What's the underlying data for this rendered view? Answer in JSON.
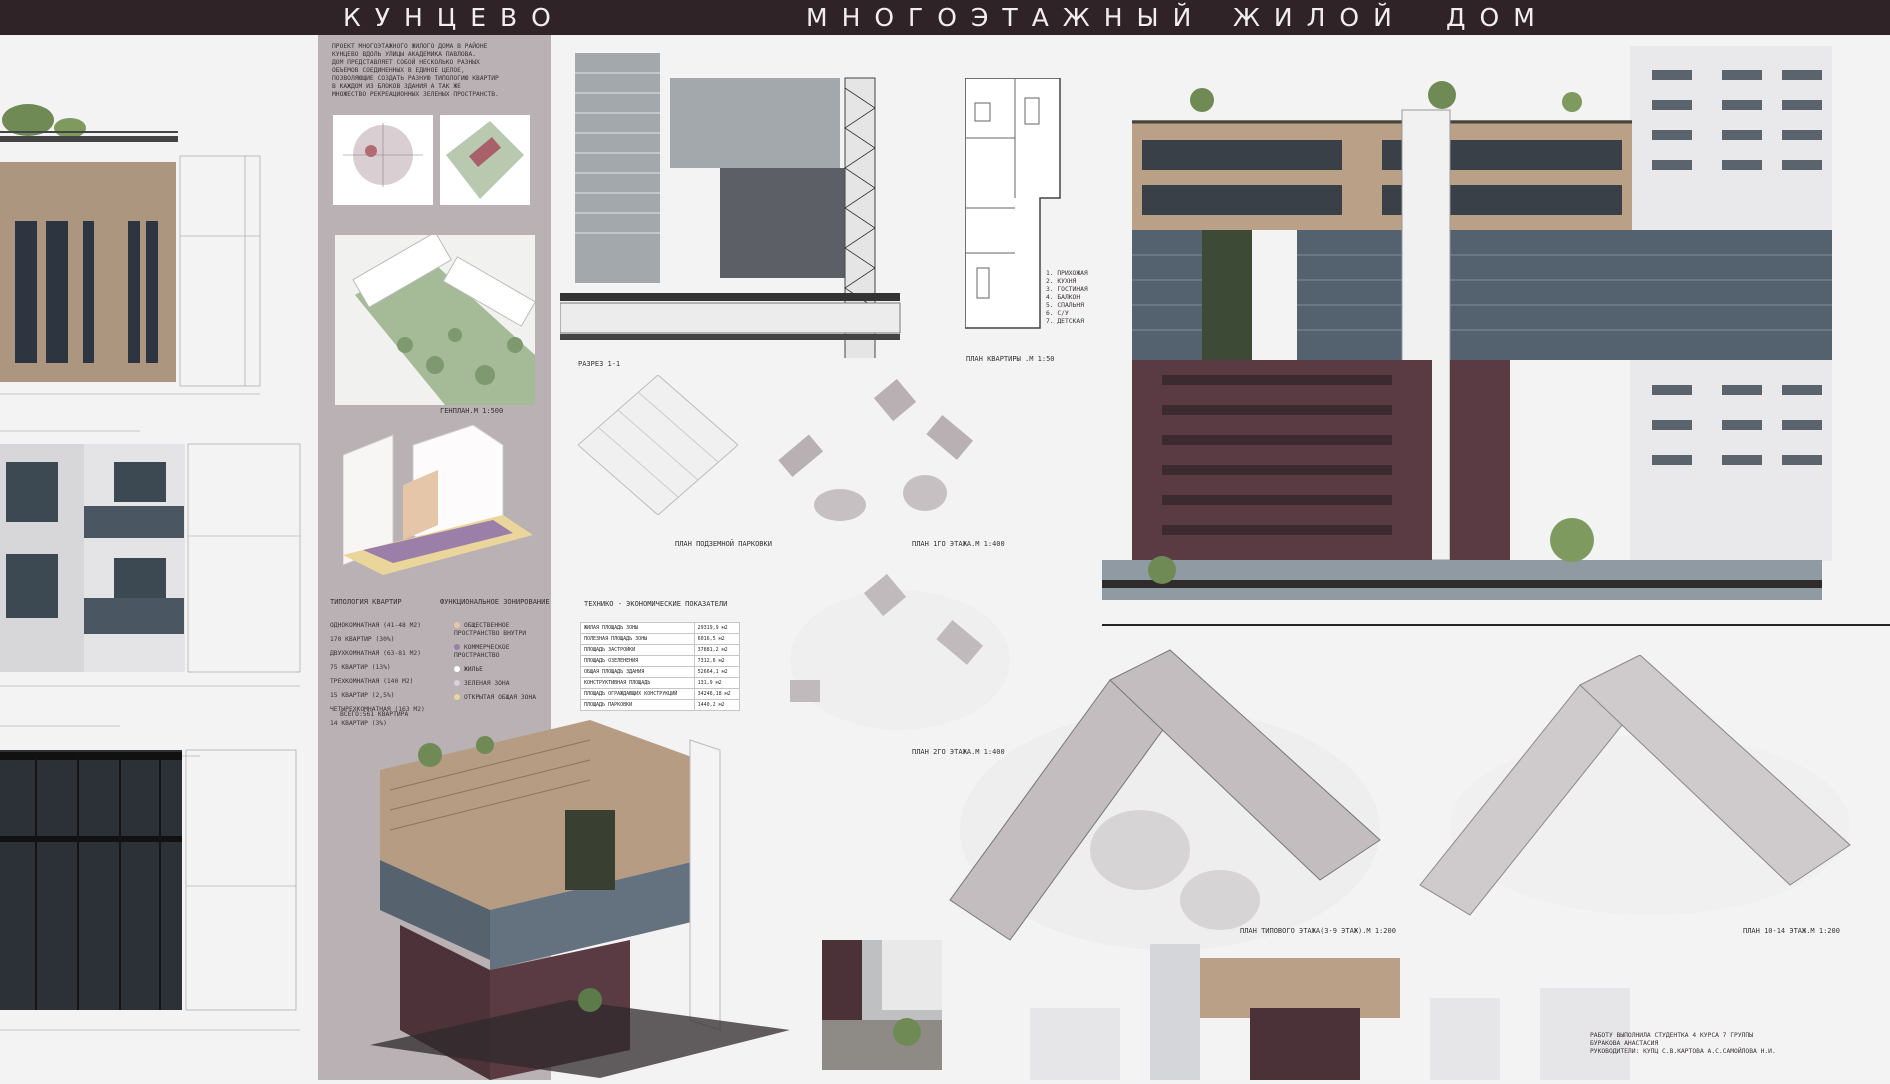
{
  "header": {
    "district": "КУНЦЕВО",
    "title_words": [
      "МНОГОЭТАЖНЫЙ",
      "ЖИЛОЙ",
      "ДОМ"
    ]
  },
  "description": "ПРОЕКТ МНОГОЭТАЖНОГО ЖИЛОГО ДОМА В РАЙОНЕ\nКУНЦЕВО ВДОЛЬ УЛИЦЫ АКАДЕМИКА ПАВЛОВА.\nДОМ ПРЕДСТАВЛЯЕТ СОБОЙ НЕСКОЛЬКО РАЗНЫХ\nОБЪЕМОВ СОЕДИНЕННЫХ В ЕДИНОЕ ЦЕЛОЕ,\nПОЗВОЛЯЮЩИЕ СОЗДАТЬ РАЗНУЮ ТИПОЛОГИЮ КВАРТИР\nВ КАЖДОМ ИЗ БЛОКОВ ЗДАНИЯ А ТАК ЖЕ\nМНОЖЕСТВО РЕКРЕАЦИОННЫХ ЗЕЛЕНЫХ ПРОСТРАНСТВ.",
  "labels": {
    "genplan": "ГЕНПЛАН.М 1:500",
    "typology": "ТИПОЛОГИЯ КВАРТИР",
    "zoning": "ФУНКЦИОНАЛЬНОЕ ЗОНИРОВАНИЕ",
    "section": "РАЗРЕЗ 1-1",
    "apartment_plan": "ПЛАН КВАРТИРЫ .М 1:50",
    "parking_plan": "ПЛАН ПОДЗЕМНОЙ ПАРКОВКИ",
    "floor1_plan": "ПЛАН 1ГО ЭТАЖА.М 1:400",
    "floor2_plan": "ПЛАН 2ГО ЭТАЖА.М 1:400",
    "tep_title": "ТЕХНИКО - ЭКОНОМИЧЕСКИЕ ПОКАЗАТЕЛИ",
    "typical_floor_plan": "ПЛАН ТИПОВОГО ЭТАЖА(3-9 ЭТАЖ).М 1:200",
    "floor_10_14_plan": "ПЛАН 10-14 ЭТАЖ.М 1:200"
  },
  "apartment_legend": [
    "1. ПРИХОЖАЯ",
    "2. КУХНЯ",
    "3. ГОСТИНАЯ",
    "4. БАЛКОН",
    "5. СПАЛЬНЯ",
    "6. С/У",
    "7. ДЕТСКАЯ"
  ],
  "typology_list": [
    "ОДНОКОМНАТНАЯ (41-48 М2)",
    "170 КВАРТИР (30%)",
    "ДВУХКОМНАТНАЯ (63-81 М2)",
    "75 КВАРТИР (13%)",
    "ТРЕХКОМНАТНАЯ (140 М2)",
    "15 КВАРТИР (2,5%)",
    "ЧЕТЫРЕХКОМНАТНАЯ (163 М2)",
    "14 КВАРТИР (3%)"
  ],
  "typology_total": "ВСЕГО:561 КВАРТИРА",
  "zoning_legend": [
    {
      "label": "ОБЩЕСТВЕННОЕ ПРОСТРАНСТВО ВНУТРИ",
      "color": "#e8c7a8"
    },
    {
      "label": "КОММЕРЧЕСКОЕ ПРОСТРАНСТВО",
      "color": "#9b7fa8"
    },
    {
      "label": "ЖИЛЬЕ",
      "color": "#ffffff"
    },
    {
      "label": "ЗЕЛЕНАЯ ЗОНА",
      "color": "#d9d0e4"
    },
    {
      "label": "ОТКРЫТАЯ ОБЩАЯ ЗОНА",
      "color": "#ead59a"
    }
  ],
  "tep_rows": [
    [
      "ЖИЛАЯ ПЛОЩАДЬ ЗОНЫ",
      "29319,9 м2"
    ],
    [
      "ПОЛЕЗНАЯ ПЛОЩАДЬ ЗОНЫ",
      "6016,5 м2"
    ],
    [
      "ПЛОЩАДЬ ЗАСТРОЙКИ",
      "37881,2 м2"
    ],
    [
      "ПЛОЩАДЬ ОЗЕЛЕНЕНИЯ",
      "7312,6 м2"
    ],
    [
      "ОБЩАЯ ПЛОЩАДЬ ЗДАНИЯ",
      "52664,1 м2"
    ],
    [
      "КОНСТРУКТИВНАЯ ПЛОЩАДЬ",
      "131,9 м2"
    ],
    [
      "ПЛОЩАДЬ ОГРАЖДАЮЩИХ КОНСТРУКЦИЙ",
      "34246,18 м2"
    ],
    [
      "ПЛОЩАДЬ ПАРКОВКИ",
      "1440,2 м2"
    ]
  ],
  "credits": [
    "РАБОТУ ВЫПОЛНИЛА СТУДЕНТКА 4 КУРСА 7 ГРУППЫ",
    "БУРАКОВА АНАСТАСИЯ",
    "РУКОВОДИТЕЛИ: КУПЦ С.В.КАРТОВА А.С.САМОЙЛОВА Н.И."
  ],
  "colors": {
    "header": "#2f2327",
    "taupe_panel": "#b9b1b3",
    "brick": "#5a3a43",
    "beige": "#b9a087",
    "glass": "#54626f"
  }
}
